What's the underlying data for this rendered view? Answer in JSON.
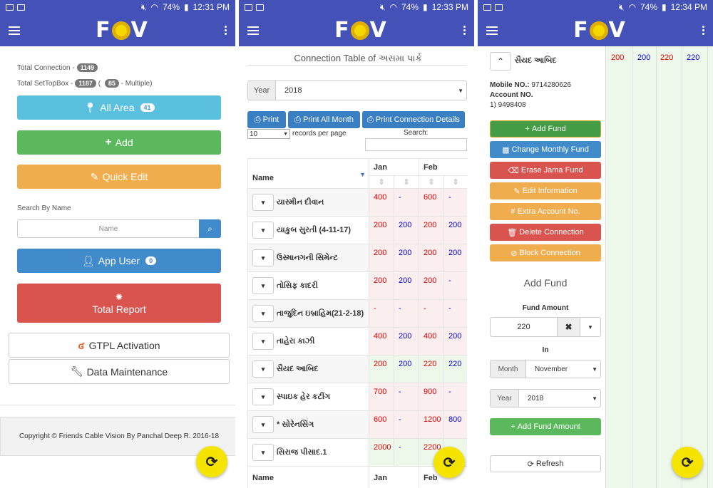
{
  "status_bars": [
    {
      "battery": "74%",
      "time": "12:31 PM"
    },
    {
      "battery": "74%",
      "time": "12:33 PM"
    },
    {
      "battery": "74%",
      "time": "12:34 PM"
    }
  ],
  "app": {
    "logo": "FCV"
  },
  "screen1": {
    "total_connection_label": "Total Connection -",
    "total_connection": "1149",
    "total_settopbox_label": "Total SetTopBox -",
    "total_settopbox": "1187",
    "paren_open": "(",
    "multiple": "85",
    "multiple_label": "- Multiple)",
    "all_area": "All Area",
    "all_area_count": "41",
    "add": "Add",
    "quick_edit": "Quick Edit",
    "search_label": "Search By Name",
    "name_placeholder": "Name",
    "app_user": "App User",
    "app_user_count": "0",
    "total_report": "Total Report",
    "gtpl": "GTPL Activation",
    "data_maintenance": "Data Maintenance",
    "footer": "Copyright © Friends Cable Vision By Panchal Deep R. 2016-18"
  },
  "screen2": {
    "title": "Connection Table of અસમા પાર્ક",
    "year_label": "Year",
    "year_value": "2018",
    "print": "Print",
    "print_all": "Print All Month",
    "print_details": "Print Connection Details",
    "per_page_value": "10",
    "per_page_label": "records per page",
    "search_label": "Search:",
    "col_name": "Name",
    "col_jan": "Jan",
    "col_feb": "Feb",
    "rows": [
      {
        "name": "યાસ્મીન દીવાન",
        "jan_a": "400",
        "jan_b": "-",
        "feb_a": "600",
        "feb_b": "-"
      },
      {
        "name": "યાકુબ સુરતી (4-11-17)",
        "jan_a": "200",
        "jan_b": "200",
        "feb_a": "200",
        "feb_b": "200"
      },
      {
        "name": "ઉસ્માનગની સિમેન્ટ",
        "jan_a": "200",
        "jan_b": "200",
        "feb_a": "200",
        "feb_b": "200"
      },
      {
        "name": "તોસિફ કાદરી",
        "jan_a": "200",
        "jan_b": "200",
        "feb_a": "200",
        "feb_b": "-"
      },
      {
        "name": "તાજુદિન ઇબ્રાહિમ(21-2-18)",
        "jan_a": "-",
        "jan_b": "-",
        "feb_a": "-",
        "feb_b": "-"
      },
      {
        "name": "તાહેરા કાઝી",
        "jan_a": "400",
        "jan_b": "200",
        "feb_a": "400",
        "feb_b": "200"
      },
      {
        "name": "સૈયદ આબિદ",
        "jan_a": "200",
        "jan_b": "200",
        "feb_a": "220",
        "feb_b": "220"
      },
      {
        "name": "સ્પાઇક હેર કટીંગ",
        "jan_a": "700",
        "jan_b": "-",
        "feb_a": "900",
        "feb_b": "-"
      },
      {
        "name": "* સોરેનસિંગ",
        "jan_a": "600",
        "jan_b": "-",
        "feb_a": "1200",
        "feb_b": "800"
      },
      {
        "name": "સિરાજ પીસાદ.1",
        "jan_a": "2000",
        "jan_b": "-",
        "feb_a": "2200",
        "feb_b": ""
      }
    ]
  },
  "screen3": {
    "name": "સૈયદ આબિદ",
    "mobile_label": "Mobile NO.:",
    "mobile": "9714280626",
    "account_label": "Account NO.",
    "account": "1) 9498408",
    "add_fund": "Add Fund",
    "change_monthly": "Change Monthly Fund",
    "erase_jama": "Erase Jama Fund",
    "edit_info": "Edit Information",
    "extra_account": "# Extra Account No.",
    "delete_conn": "Delete Connection",
    "block_conn": "Block Connection",
    "add_fund_title": "Add Fund",
    "fund_amount_label": "Fund Amount",
    "fund_amount": "220",
    "in_label": "In",
    "month_label": "Month",
    "month_value": "November",
    "year_label": "Year",
    "year_value": "2018",
    "add_fund_amount": "Add Fund Amount",
    "refresh": "Refresh",
    "bg_values": [
      "200",
      "200",
      "220",
      "220"
    ]
  },
  "colors": {
    "primary": "#4452b8",
    "info": "#5bc0de",
    "success": "#5cb85c",
    "warning": "#f0ad4e",
    "danger": "#d9534f",
    "blue_btn": "#428bca",
    "fab": "#f5e400"
  }
}
